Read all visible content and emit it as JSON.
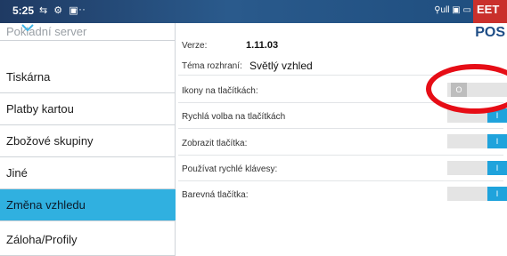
{
  "statusbar": {
    "time": "5:25",
    "icons": "⇆ ⚙ ▣",
    "more": "···",
    "right": "⚲ull ▣ ▭",
    "brand_text": "EET",
    "logo": "POS"
  },
  "sidebar": {
    "items": [
      {
        "label": "Pokladní server"
      },
      {
        "label": "Tiskárna"
      },
      {
        "label": "Platby kartou"
      },
      {
        "label": "Zbožové skupiny"
      },
      {
        "label": "Jiné"
      },
      {
        "label": "Změna vzhledu"
      },
      {
        "label": "Záloha/Profily"
      }
    ],
    "active": "Změna vzhledu"
  },
  "content": {
    "version_label": "Verze:",
    "version_value": "1.11.03",
    "theme_label": "Téma rozhraní:",
    "theme_value": "Světlý vzhled",
    "settings": [
      {
        "label": "Ikony na tlačítkách:",
        "state": "O",
        "on": false
      },
      {
        "label": "Rychlá volba na tlačítkách",
        "state": "I",
        "on": true
      },
      {
        "label": "Zobrazit tlačítka:",
        "state": "I",
        "on": true
      },
      {
        "label": "Používat rychlé klávesy:",
        "state": "I",
        "on": true
      },
      {
        "label": "Barevná tlačítka:",
        "state": "I",
        "on": true
      }
    ]
  },
  "colors": {
    "accent": "#30b0e0",
    "toggle_on": "#1fa3dc",
    "annotation": "#e60d16"
  }
}
